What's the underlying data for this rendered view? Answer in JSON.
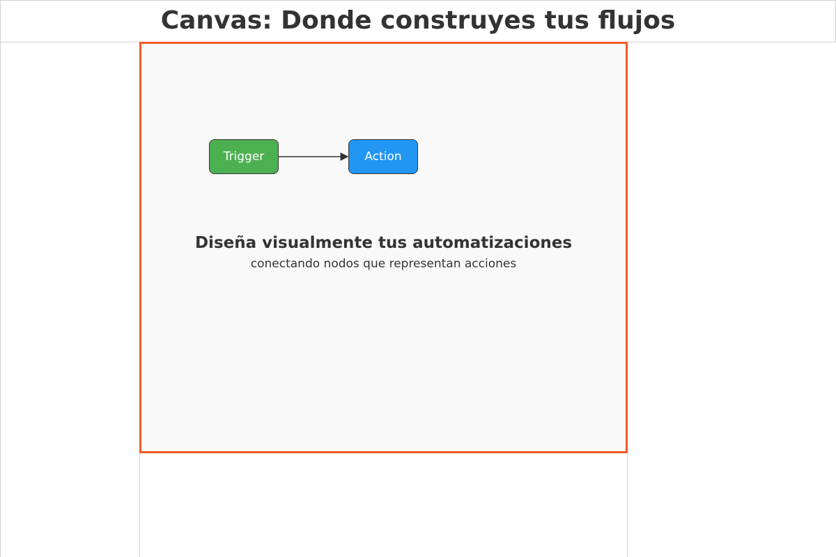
{
  "header": {
    "title": "Canvas: Donde construyes tus flujos"
  },
  "canvas": {
    "nodes": [
      {
        "label": "Trigger",
        "color": "#4caf50"
      },
      {
        "label": "Action",
        "color": "#2196f3"
      }
    ],
    "heading": "Diseña visualmente tus automatizaciones",
    "subheading": "conectando nodos que representan acciones"
  },
  "colors": {
    "canvas_border": "#f05a28",
    "canvas_background": "#f9f9f9",
    "text": "#333333",
    "divider": "#d0d0d0"
  }
}
